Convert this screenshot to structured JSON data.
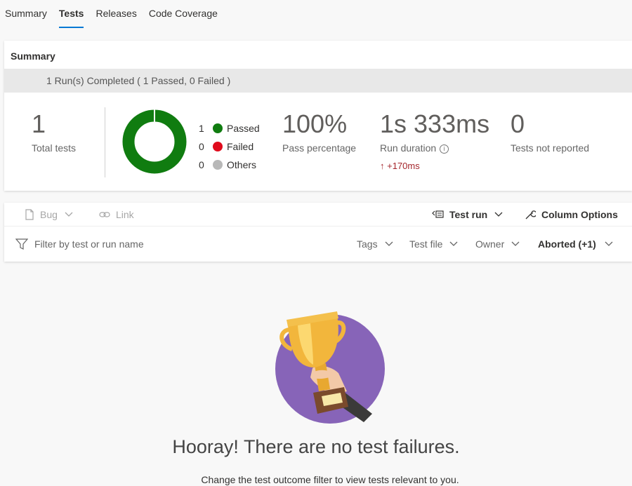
{
  "tabs": [
    {
      "label": "Summary"
    },
    {
      "label": "Tests"
    },
    {
      "label": "Releases"
    },
    {
      "label": "Code Coverage"
    }
  ],
  "summary": {
    "title": "Summary",
    "runs_text": "1 Run(s) Completed ( 1 Passed, 0 Failed )",
    "total_tests": {
      "value": "1",
      "label": "Total tests"
    },
    "donut": {
      "passed": 1,
      "failed": 0,
      "others": 0
    },
    "legend": [
      {
        "count": "1",
        "label": "Passed",
        "color": "#107c10"
      },
      {
        "count": "0",
        "label": "Failed",
        "color": "#e00b1c"
      },
      {
        "count": "0",
        "label": "Others",
        "color": "#b8b8b8"
      }
    ],
    "pass_percentage": {
      "value": "100%",
      "label": "Pass percentage"
    },
    "run_duration": {
      "value": "1s 333ms",
      "label": "Run duration",
      "delta": "+170ms"
    },
    "not_reported": {
      "value": "0",
      "label": "Tests not reported"
    }
  },
  "toolbar": {
    "bug_label": "Bug",
    "link_label": "Link",
    "test_run_label": "Test run",
    "column_options_label": "Column Options"
  },
  "filters": {
    "search_placeholder": "Filter by test or run name",
    "tags_label": "Tags",
    "test_file_label": "Test file",
    "owner_label": "Owner",
    "outcome_label": "Aborted (+1)"
  },
  "empty_state": {
    "title": "Hooray! There are no test failures.",
    "subtitle": "Change the test outcome filter to view tests relevant to you."
  },
  "colors": {
    "accent": "#0078d4",
    "passed": "#107c10",
    "failed": "#e00b1c",
    "illustration_bg": "#8764b8",
    "trophy": "#f2b63c"
  }
}
